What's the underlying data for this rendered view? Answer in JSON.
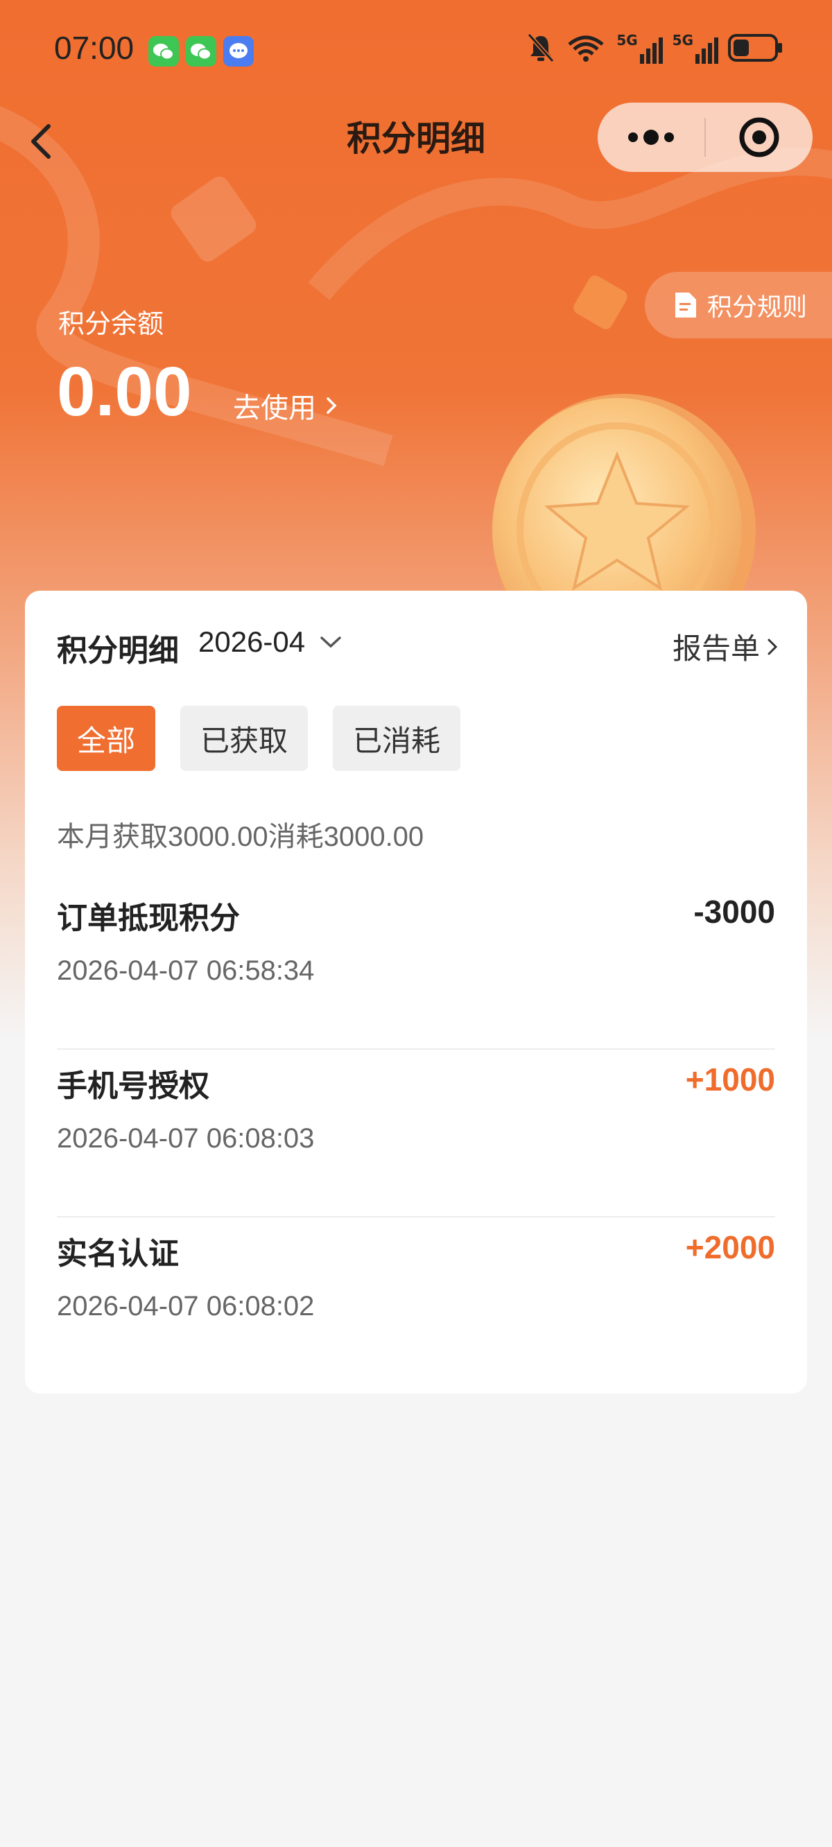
{
  "status_bar": {
    "time": "07:00",
    "icons": [
      "wechat-icon",
      "wechat-icon",
      "message-icon",
      "bell-mute-icon",
      "wifi-icon",
      "5g-signal-icon",
      "5g-signal-icon",
      "battery-icon"
    ],
    "network_label_1": "5G",
    "network_label_2": "5G"
  },
  "nav": {
    "title": "积分明细"
  },
  "hero": {
    "balance_label": "积分余额",
    "balance_value": "0.00",
    "use_link": "去使用",
    "rules_button": "积分规则"
  },
  "card": {
    "title": "积分明细",
    "month": "2026-04",
    "report_link": "报告单",
    "filters": [
      {
        "label": "全部",
        "active": true
      },
      {
        "label": "已获取",
        "active": false
      },
      {
        "label": "已消耗",
        "active": false
      }
    ],
    "summary": "本月获取3000.00消耗3000.00",
    "transactions": [
      {
        "name": "订单抵现积分",
        "amount": "-3000",
        "time": "2026-04-07 06:58:34"
      },
      {
        "name": "手机号授权",
        "amount": "+1000",
        "time": "2026-04-07 06:08:03"
      },
      {
        "name": "实名认证",
        "amount": "+2000",
        "time": "2026-04-07 06:08:02"
      }
    ]
  },
  "colors": {
    "accent": "#f06e30",
    "positive_amount": "#ef6c2c",
    "background": "#f5f5f5"
  }
}
